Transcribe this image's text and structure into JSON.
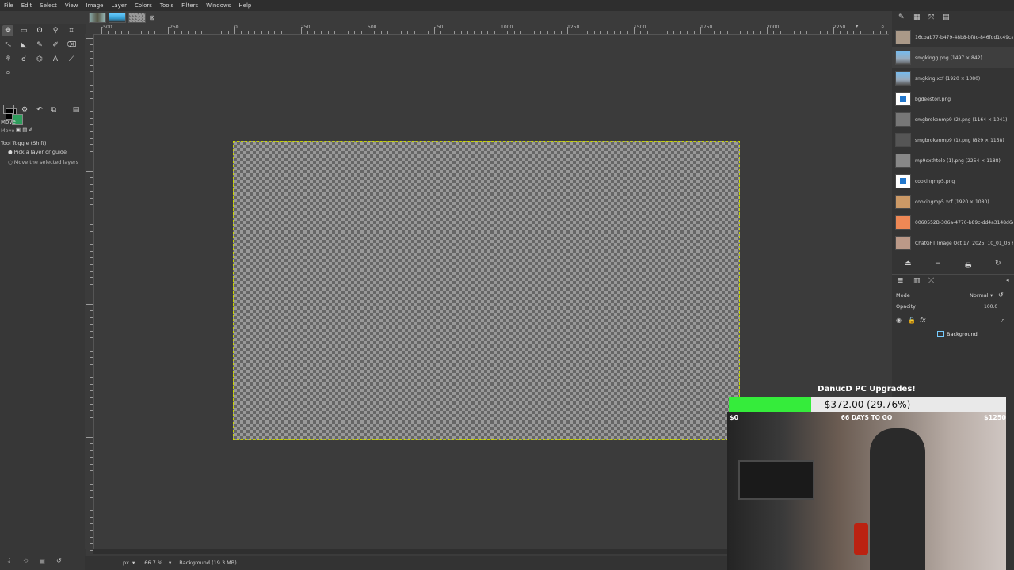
{
  "menubar": {
    "items": [
      "File",
      "Edit",
      "Select",
      "View",
      "Image",
      "Layer",
      "Colors",
      "Tools",
      "Filters",
      "Windows",
      "Help"
    ]
  },
  "toolbox": {
    "tool_name": "Move",
    "options_title": "Tool Toggle  (Shift)",
    "option_pick": "Pick a layer or guide",
    "option_move": "Move the selected layers",
    "fg_color": "#000000",
    "bg_color": "#2e9d5c"
  },
  "hruler": {
    "labels": [
      "-500",
      "-250",
      "0",
      "250",
      "500",
      "750",
      "1000",
      "1250",
      "1500",
      "1750",
      "2000",
      "2250"
    ]
  },
  "statusbar": {
    "unit": "px",
    "zoom": "66.7 %",
    "layer_info": "Background (19.3 MB)"
  },
  "images_panel": {
    "items": [
      {
        "name": "16cbab77-b479-48b8-bf8c-846fdd1c49ca",
        "icon": "photo-thumb"
      },
      {
        "name": "smgkingg.png (1497 × 842)",
        "icon": "photo-thumb"
      },
      {
        "name": "smgking.xcf (1920 × 1080)",
        "icon": "photo-thumb"
      },
      {
        "name": "bgdeeston.png",
        "icon": "image-file-icon"
      },
      {
        "name": "smgbrokenmp9 (2).png (1164 × 1041)",
        "icon": "photo-thumb"
      },
      {
        "name": "smgbrokenmp9 (1).png (829 × 1158)",
        "icon": "photo-thumb"
      },
      {
        "name": "mp9exthtolo (1).png (2254 × 1188)",
        "icon": "photo-thumb"
      },
      {
        "name": "cookingmp5.png",
        "icon": "image-file-icon"
      },
      {
        "name": "cookingmp5.xcf (1920 × 1080)",
        "icon": "photo-thumb"
      },
      {
        "name": "0060552B-306a-4770-b89c-dd4a3148d6ec",
        "icon": "photo-thumb"
      },
      {
        "name": "ChatGPT Image Oct 17, 2025, 10_01_06 PM",
        "icon": "photo-thumb"
      }
    ]
  },
  "layers_panel": {
    "mode_label": "Mode",
    "mode_value": "Normal",
    "opacity_label": "Opacity",
    "opacity_value": "100.0",
    "layer_name": "Background"
  },
  "donation": {
    "title": "DanucD PC Upgrades!",
    "amount": "$372.00 (29.76%)",
    "progress": 0.2976,
    "days": "66 DAYS TO GO",
    "min": "$0",
    "max": "$1250"
  }
}
